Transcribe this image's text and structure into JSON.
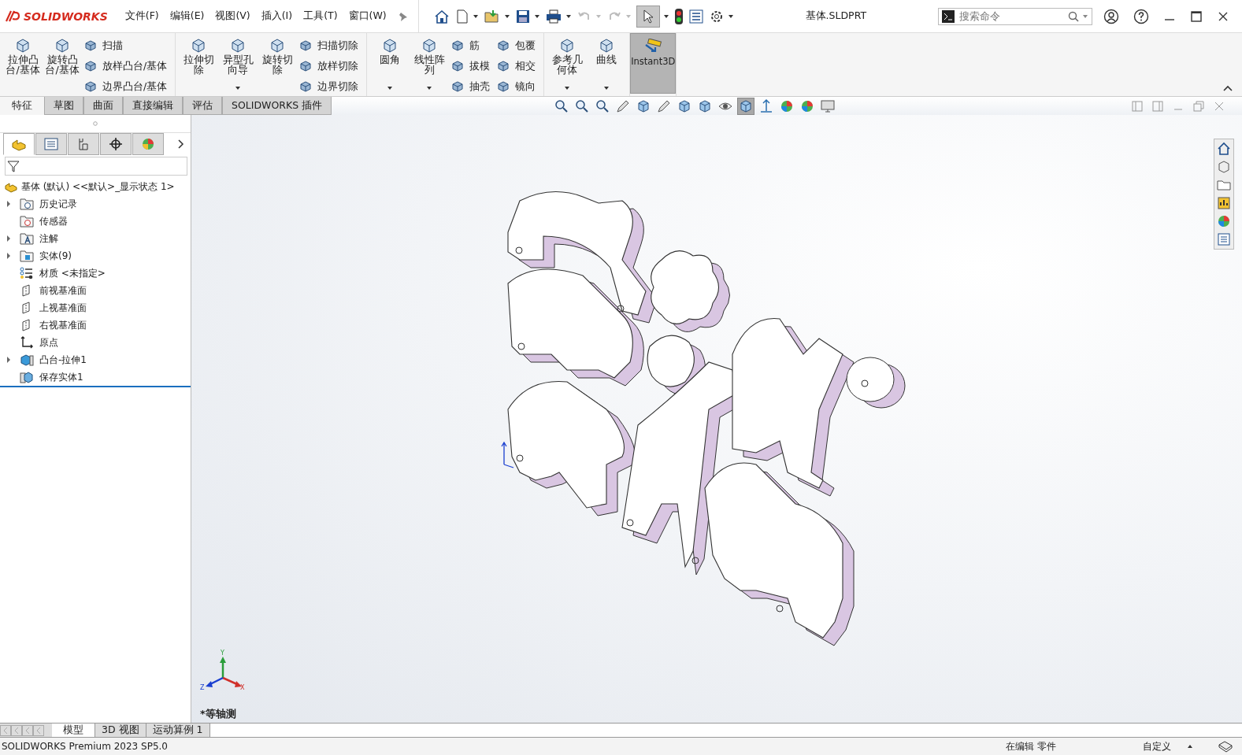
{
  "app": {
    "logo": "SOLIDWORKS"
  },
  "menu": [
    "文件(F)",
    "编辑(E)",
    "视图(V)",
    "插入(I)",
    "工具(T)",
    "窗口(W)"
  ],
  "title": "基体.SLDPRT",
  "search": {
    "placeholder": "搜索命令"
  },
  "ribbon": {
    "groups": [
      {
        "items": [
          {
            "kind": "large",
            "label": "拉伸凸台/基体",
            "dropdown": false
          },
          {
            "kind": "large",
            "label": "旋转凸台/基体",
            "dropdown": false
          },
          {
            "kind": "stack",
            "items": [
              "扫描",
              "放样凸台/基体",
              "边界凸台/基体"
            ]
          }
        ]
      },
      {
        "items": [
          {
            "kind": "large",
            "label": "拉伸切除",
            "dropdown": false
          },
          {
            "kind": "large",
            "label": "异型孔向导",
            "dropdown": true
          },
          {
            "kind": "large",
            "label": "旋转切除",
            "dropdown": false
          },
          {
            "kind": "stack",
            "items": [
              "扫描切除",
              "放样切除",
              "边界切除"
            ]
          }
        ]
      },
      {
        "items": [
          {
            "kind": "large",
            "label": "圆角",
            "dropdown": true
          },
          {
            "kind": "large",
            "label": "线性阵列",
            "dropdown": true
          },
          {
            "kind": "stack",
            "items": [
              "筋",
              "拔模",
              "抽壳"
            ]
          },
          {
            "kind": "stack",
            "items": [
              "包覆",
              "相交",
              "镜向"
            ]
          }
        ]
      },
      {
        "items": [
          {
            "kind": "large",
            "label": "参考几何体",
            "dropdown": true
          },
          {
            "kind": "large",
            "label": "曲线",
            "dropdown": true
          }
        ]
      },
      {
        "items": [
          {
            "kind": "toggle",
            "label": "Instant3D",
            "on": true
          }
        ]
      }
    ]
  },
  "tabs": [
    {
      "label": "特征",
      "selected": true
    },
    {
      "label": "草图",
      "selected": false
    },
    {
      "label": "曲面",
      "selected": false
    },
    {
      "label": "直接编辑",
      "selected": false
    },
    {
      "label": "评估",
      "selected": false
    },
    {
      "label": "SOLIDWORKS 插件",
      "selected": false
    }
  ],
  "panel_tabs": [
    {
      "kind": "feature",
      "selected": true
    },
    {
      "kind": "property",
      "selected": false
    },
    {
      "kind": "config",
      "selected": false
    },
    {
      "kind": "dim",
      "selected": false
    },
    {
      "kind": "display",
      "selected": false
    }
  ],
  "tree": {
    "root": "基体 (默认) <<默认>_显示状态 1>",
    "items": [
      {
        "kind": "history",
        "label": "历史记录",
        "has_children": true
      },
      {
        "kind": "sensor",
        "label": "传感器",
        "has_children": false
      },
      {
        "kind": "annotation",
        "label": "注解",
        "has_children": true
      },
      {
        "kind": "solid",
        "label": "实体(9)",
        "has_children": true
      },
      {
        "kind": "material",
        "label": "材质 <未指定>",
        "has_children": false
      },
      {
        "kind": "plane",
        "label": "前视基准面",
        "has_children": false
      },
      {
        "kind": "plane",
        "label": "上视基准面",
        "has_children": false
      },
      {
        "kind": "plane",
        "label": "右视基准面",
        "has_children": false
      },
      {
        "kind": "origin",
        "label": "原点",
        "has_children": false
      },
      {
        "kind": "feature",
        "label": "凸台-拉伸1",
        "has_children": true
      },
      {
        "kind": "body",
        "label": "保存实体1",
        "has_children": false
      }
    ]
  },
  "viewport": {
    "view_label": "*等轴测",
    "axes": [
      "Y",
      "X",
      "Z"
    ]
  },
  "bottom_tabs": [
    {
      "label": "模型",
      "selected": true
    },
    {
      "label": "3D 视图",
      "selected": false
    },
    {
      "label": "运动算例 1",
      "selected": false
    }
  ],
  "status": {
    "product": "SOLIDWORKS Premium 2023 SP5.0",
    "mode": "在编辑 零件",
    "units": "自定义"
  }
}
